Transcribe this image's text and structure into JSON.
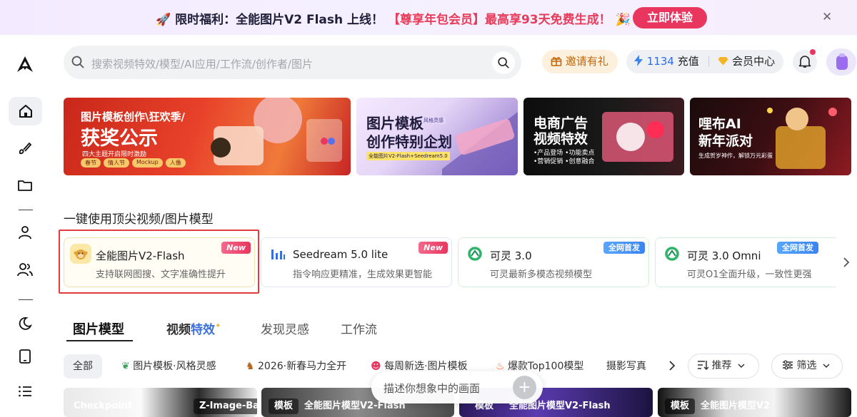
{
  "promo": {
    "prefix": "限时福利：全能图片V2 Flash 上线！",
    "highlight": "【尊享年包会员】最高享93天免费生成！",
    "cta": "立即体验",
    "close": "✕"
  },
  "sidebar": {
    "items": [
      "home-icon",
      "edit-brush-icon",
      "folder-icon",
      "user-icon",
      "users-icon",
      "moon-icon",
      "tablet-icon",
      "list-icon"
    ]
  },
  "search": {
    "placeholder": "搜索视频特效/模型/AI应用/工作流/创作者/图片"
  },
  "header": {
    "invite": "邀请有礼",
    "credits": "1134",
    "recharge": "充值",
    "member": "会员中心"
  },
  "banners": [
    {
      "line1": "图片模板创作\\狂欢季/",
      "line2": "获奖公示",
      "line3": "四大主题开启限时激励",
      "chips": [
        "春节",
        "情人节",
        "Mockup",
        "人像"
      ]
    },
    {
      "line1": "图片模板",
      "line2": "创作特别企划",
      "badge": "风格灵感",
      "line3": "全能图片V2-Flash+Seedream5.0"
    },
    {
      "line1": "电商广告",
      "line2": "视频特效",
      "line3": "•产品登场  •功能卖点",
      "line4": "•营销促销  •创意融合"
    },
    {
      "line1": "哩布AI",
      "line2": "新年派对",
      "line3": "生成贺岁神作，解锁万元彩蛋"
    }
  ],
  "section_title": "一键使用顶尖视频/图片模型",
  "models": [
    {
      "name": "全能图片V2-Flash",
      "desc": "支持联网图搜、文字准确性提升",
      "tag": "New"
    },
    {
      "name": "Seedream 5.0 lite",
      "desc": "指令响应更精准，生成效果更智能",
      "tag": "New"
    },
    {
      "name": "可灵 3.0",
      "desc": "可灵最新多模态视频模型",
      "tag": "全网首发"
    },
    {
      "name": "可灵 3.0 Omni",
      "desc": "可灵O1全面升级，一致性更强",
      "tag": "全网首发"
    }
  ],
  "tabs": {
    "image": "图片模型",
    "video_a": "视频",
    "video_b": "特效",
    "discover": "发现灵感",
    "workflow": "工作流"
  },
  "chips": {
    "all": "全部",
    "c1": "图片模板·风格灵感",
    "c2": "2026·新春马力全开",
    "c3": "每周新选·图片模板",
    "c4": "爆款Top100模型",
    "c5": "摄影写真",
    "sort": "推荐",
    "filter": "筛选"
  },
  "thumbs": [
    {
      "t1": "Checkpoint",
      "t2": "Z-Image-Base"
    },
    {
      "t1": "模板",
      "t2": "全能图片模型V2-Flash"
    },
    {
      "t1": "模板",
      "t2": "全能图片模型V2-Flash"
    },
    {
      "t1": "模板",
      "t2": "全能图片模型V2"
    }
  ],
  "prompt": {
    "text": "描述你想象中的画面",
    "plus": "+"
  }
}
